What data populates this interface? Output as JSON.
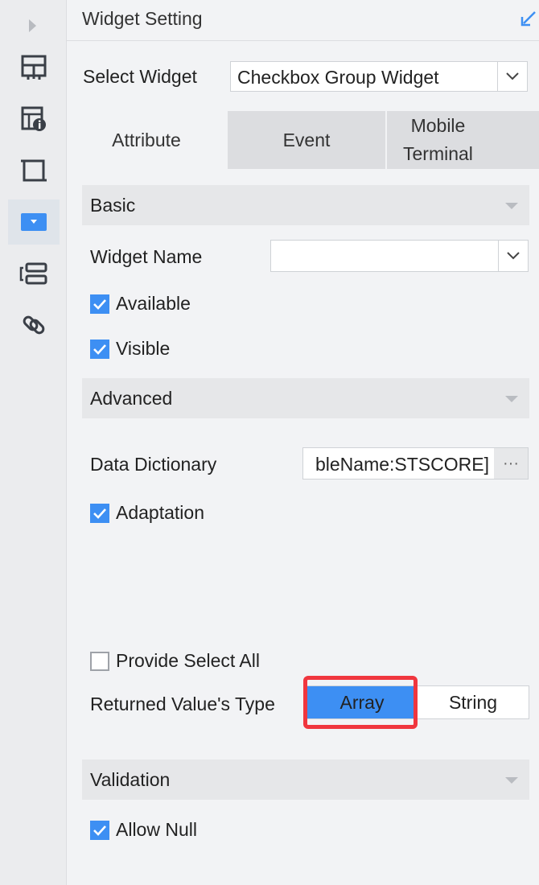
{
  "header": {
    "title": "Widget Setting"
  },
  "select_widget": {
    "label": "Select Widget",
    "value": "Checkbox Group Widget"
  },
  "tabs": [
    {
      "label": "Attribute",
      "active": true
    },
    {
      "label": "Event",
      "active": false
    },
    {
      "label_line1": "Mobile",
      "label_line2": "Terminal",
      "active": false
    }
  ],
  "sections": {
    "basic": "Basic",
    "advanced": "Advanced",
    "validation": "Validation"
  },
  "fields": {
    "widget_name_label": "Widget Name",
    "widget_name_value": "",
    "available": {
      "label": "Available",
      "checked": true
    },
    "visible": {
      "label": "Visible",
      "checked": true
    },
    "data_dictionary_label": "Data Dictionary",
    "data_dictionary_value": "bleName:STSCORE]",
    "data_dictionary_button": "···",
    "adaptation": {
      "label": "Adaptation",
      "checked": true
    },
    "provide_select_all": {
      "label": "Provide Select All",
      "checked": false
    },
    "returned_type_label": "Returned Value's Type",
    "returned_type_options": [
      "Array",
      "String"
    ],
    "returned_type_selected": "Array",
    "allow_null": {
      "label": "Allow Null",
      "checked": true
    }
  },
  "colors": {
    "accent": "#3d8ff3",
    "highlight": "#f0363e"
  },
  "icons": [
    "expand-arrow-icon",
    "layout-grid-icon",
    "table-info-icon",
    "frame-icon",
    "dropdown-widget-icon",
    "form-layout-icon",
    "link-icon",
    "pin-arrow-icon",
    "chevron-down-icon"
  ]
}
